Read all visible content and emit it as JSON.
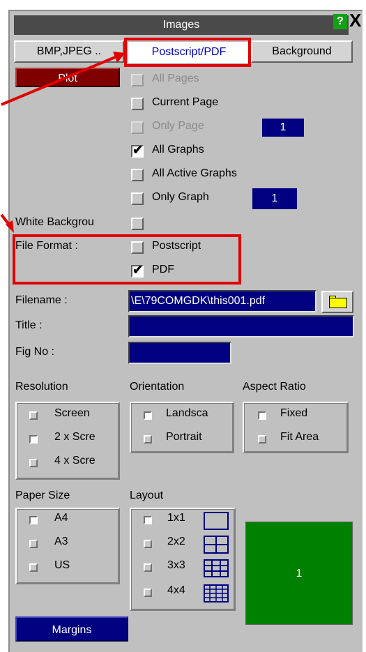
{
  "window": {
    "title": "Images",
    "help": "?",
    "close": "X"
  },
  "tabs": {
    "bmp": "BMP,JPEG ..",
    "postscript": "Postscript/PDF",
    "background": "Background"
  },
  "plot_label": "Plot",
  "pages": {
    "all_pages": "All Pages",
    "current_page": "Current Page",
    "only_page": "Only Page",
    "only_page_value": "1"
  },
  "graphs": {
    "all_graphs": "All Graphs",
    "all_active_graphs": "All Active Graphs",
    "only_graph": "Only Graph",
    "only_graph_value": "1"
  },
  "white_background": "White Backgrou",
  "file_format": {
    "label": "File Format :",
    "postscript": "Postscript",
    "pdf": "PDF"
  },
  "filename": {
    "label": "Filename :",
    "value": "\\E\\79COMGDK\\this001.pdf"
  },
  "title_field": {
    "label": "Title :",
    "value": ""
  },
  "fig_no": {
    "label": "Fig No :",
    "value": ""
  },
  "resolution": {
    "label": "Resolution",
    "options": [
      "Screen",
      "2 x Scre",
      "4 x Scre"
    ],
    "selected": "2 x Scre"
  },
  "orientation": {
    "label": "Orientation",
    "options": [
      "Landsca",
      "Portrait"
    ],
    "selected": "Landsca"
  },
  "aspect_ratio": {
    "label": "Aspect Ratio",
    "options": [
      "Fixed",
      "Fit Area"
    ],
    "selected": "Fixed"
  },
  "paper_size": {
    "label": "Paper Size",
    "options": [
      "A4",
      "A3",
      "US"
    ],
    "selected": "A4"
  },
  "layout": {
    "label": "Layout",
    "options": [
      "1x1",
      "2x2",
      "3x3",
      "4x4"
    ],
    "selected": "1x1",
    "preview": "1"
  },
  "margins_label": "Margins",
  "colors": {
    "panel": "#c0c0c0",
    "titlebar": "#4a4a4a",
    "plot": "#800000",
    "field": "#000080",
    "preview": "#008000",
    "annotation": "#e00000"
  }
}
